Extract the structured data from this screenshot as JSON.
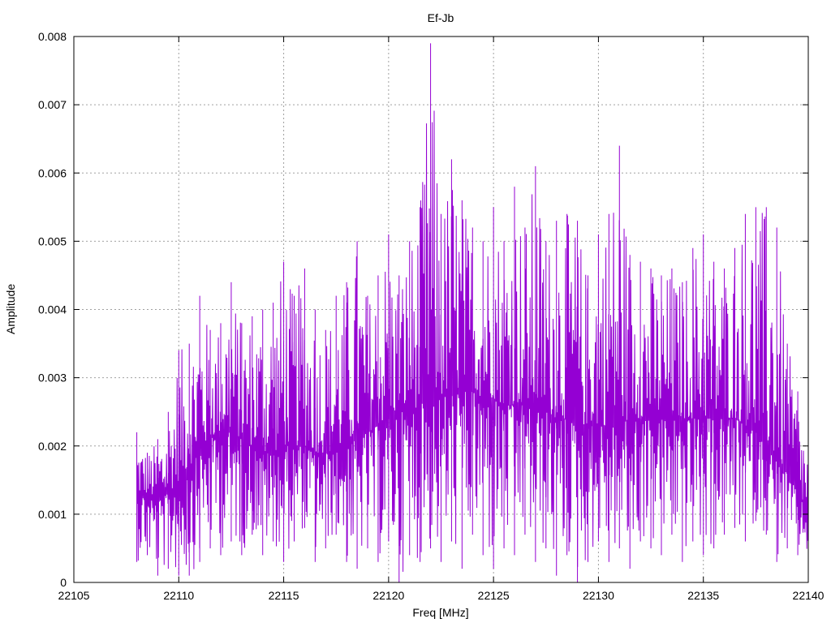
{
  "chart_data": {
    "type": "line",
    "title": "Ef-Jb",
    "xlabel": "Freq [MHz]",
    "ylabel": "Amplitude",
    "xlim": [
      22105,
      22140
    ],
    "ylim": [
      0,
      0.008
    ],
    "xticks": [
      22105,
      22110,
      22115,
      22120,
      22125,
      22130,
      22135,
      22140
    ],
    "yticks": [
      0,
      0.001,
      0.002,
      0.003,
      0.004,
      0.005,
      0.006,
      0.007,
      0.008
    ],
    "xtick_labels": [
      "22105",
      "22110",
      "22115",
      "22120",
      "22125",
      "22130",
      "22135",
      "22140"
    ],
    "ytick_labels": [
      "0",
      "0.001",
      "0.002",
      "0.003",
      "0.004",
      "0.005",
      "0.006",
      "0.007",
      "0.008"
    ],
    "grid": true,
    "legend": "none",
    "line_color": "#9400d3",
    "series": [
      {
        "x": [
          22108.0,
          22108.5,
          22109.0,
          22109.5,
          22110.0,
          22110.5,
          22111.0,
          22111.5,
          22112.0,
          22112.5,
          22113.0,
          22113.5,
          22114.0,
          22114.5,
          22115.0,
          22115.5,
          22116.0,
          22116.5,
          22117.0,
          22117.5,
          22118.0,
          22118.5,
          22119.0,
          22119.5,
          22120.0,
          22120.5,
          22121.0,
          22121.5,
          22122.0,
          22122.5,
          22123.0,
          22123.5,
          22124.0,
          22124.5,
          22125.0,
          22125.5,
          22126.0,
          22126.5,
          22127.0,
          22127.5,
          22128.0,
          22128.5,
          22129.0,
          22129.5,
          22130.0,
          22130.5,
          22131.0,
          22131.5,
          22132.0,
          22132.5,
          22133.0,
          22133.5,
          22134.0,
          22134.5,
          22135.0,
          22135.5,
          22136.0,
          22136.5,
          22137.0,
          22137.5,
          22138.0,
          22138.5,
          22139.0,
          22139.5,
          22140.0
        ],
        "y_center": [
          0.0013,
          0.0013,
          0.0012,
          0.0013,
          0.0015,
          0.0017,
          0.0019,
          0.0021,
          0.0022,
          0.0022,
          0.0021,
          0.002,
          0.0019,
          0.0019,
          0.002,
          0.002,
          0.002,
          0.0019,
          0.0019,
          0.0019,
          0.002,
          0.0021,
          0.0022,
          0.0023,
          0.0024,
          0.0025,
          0.0025,
          0.0026,
          0.0027,
          0.0027,
          0.0028,
          0.0028,
          0.0028,
          0.0027,
          0.0027,
          0.0026,
          0.0026,
          0.0026,
          0.0025,
          0.0025,
          0.0024,
          0.0024,
          0.0023,
          0.0023,
          0.0023,
          0.0023,
          0.0023,
          0.0024,
          0.0024,
          0.0024,
          0.0024,
          0.0024,
          0.0024,
          0.0024,
          0.0024,
          0.0024,
          0.0024,
          0.0024,
          0.0023,
          0.0022,
          0.002,
          0.0018,
          0.0016,
          0.0013,
          0.001
        ],
        "y_upper": [
          0.0022,
          0.0019,
          0.0021,
          0.0025,
          0.0034,
          0.0035,
          0.0042,
          0.0037,
          0.0038,
          0.0044,
          0.0038,
          0.0039,
          0.004,
          0.0041,
          0.0047,
          0.0042,
          0.0046,
          0.004,
          0.0037,
          0.0042,
          0.0044,
          0.005,
          0.0042,
          0.0045,
          0.0051,
          0.0045,
          0.005,
          0.0055,
          0.0079,
          0.0054,
          0.0062,
          0.0056,
          0.0052,
          0.005,
          0.0055,
          0.005,
          0.0058,
          0.0052,
          0.0061,
          0.005,
          0.0053,
          0.0054,
          0.0053,
          0.0045,
          0.0051,
          0.0054,
          0.0064,
          0.0048,
          0.0047,
          0.0046,
          0.0045,
          0.0046,
          0.0044,
          0.0049,
          0.0051,
          0.0047,
          0.0046,
          0.0049,
          0.0054,
          0.0055,
          0.0055,
          0.0052,
          0.0035,
          0.0028,
          0.002
        ],
        "y_lower": [
          0.0003,
          0.0004,
          0.0001,
          0.0002,
          0.0001,
          0.0001,
          0.0003,
          0.0005,
          0.0004,
          0.0006,
          0.0004,
          0.0007,
          0.0004,
          0.0006,
          0.0003,
          0.0006,
          0.0008,
          0.0003,
          0.0005,
          0.0007,
          0.0003,
          0.0002,
          0.0005,
          0.0003,
          0.0006,
          0.0,
          0.0004,
          0.0003,
          0.0005,
          0.0003,
          0.0006,
          0.0002,
          0.0007,
          0.0004,
          0.0002,
          0.0005,
          0.0004,
          0.0007,
          0.0003,
          0.0005,
          0.0001,
          0.0004,
          0.0,
          0.0003,
          0.0006,
          0.0003,
          0.0005,
          0.0002,
          0.0006,
          0.0005,
          0.0004,
          0.0007,
          0.0003,
          0.0006,
          0.0004,
          0.0005,
          0.0007,
          0.0008,
          0.0006,
          0.0009,
          0.0007,
          0.0003,
          0.0005,
          0.0004,
          0.0004
        ]
      }
    ]
  }
}
